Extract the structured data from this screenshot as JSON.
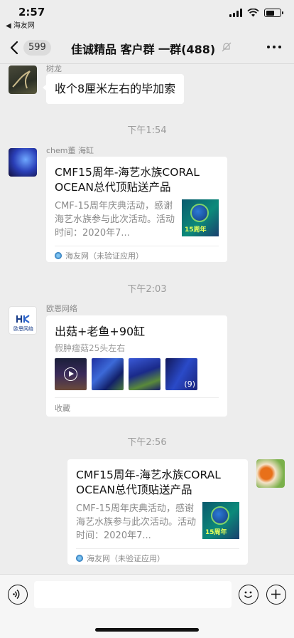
{
  "status_bar": {
    "time": "2:57",
    "back_app": "◀ 海友网"
  },
  "header": {
    "unread_count": "599",
    "title": "佳诚精品 客户群 一群(488)"
  },
  "messages": [
    {
      "sender": "树龙",
      "text": "收个8厘米左右的毕加索"
    },
    {
      "timestamp": "下午1:54"
    },
    {
      "sender": "chem董 海缸",
      "card_title": "CMF15周年-海艺水族CORAL OCEAN总代顶贴送产品",
      "card_desc": "CMF-15周年庆典活动，感谢海艺水族参与此次活动。活动时间：2020年7...",
      "thumb_label": "15周年",
      "source": "海友网（未验证应用）"
    },
    {
      "timestamp": "下午2:03"
    },
    {
      "sender": "欧恩网络",
      "post_title": "出菇+老鱼+90缸",
      "post_subtitle": "假肿瘤菇25头左右",
      "more_count": "(9)",
      "source": "收藏",
      "avatar_text": "欧恩网络"
    },
    {
      "timestamp": "下午2:56"
    },
    {
      "card_title": "CMF15周年-海艺水族CORAL OCEAN总代顶贴送产品",
      "card_desc": "CMF-15周年庆典活动，感谢海艺水族参与此次活动。活动时间：2020年7...",
      "thumb_label": "15周年",
      "source": "海友网（未验证应用）"
    }
  ],
  "colors": {
    "background": "#ededed",
    "bubble": "#ffffff",
    "meta_text": "#8a8a8a"
  }
}
